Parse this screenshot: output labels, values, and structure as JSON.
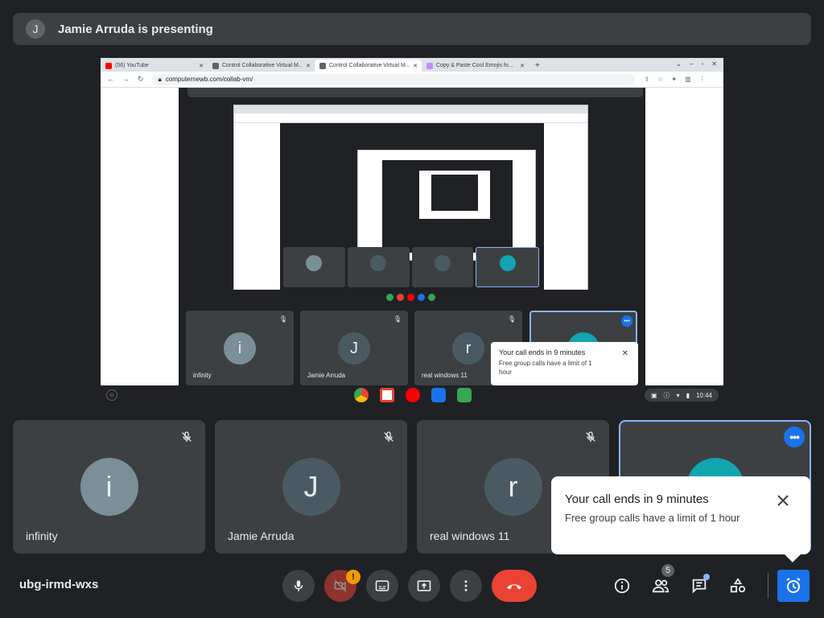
{
  "banner": {
    "avatar_letter": "J",
    "text": "Jamie Arruda is presenting"
  },
  "browser": {
    "tabs": [
      {
        "label": "(56) YouTube",
        "color": "#ff0000"
      },
      {
        "label": "Control Collaborative Virtual M...",
        "color": "#5f6368"
      },
      {
        "label": "Control Collaborative Virtual M...",
        "color": "#5f6368",
        "active": true
      },
      {
        "label": "Copy & Paste Cool Emojis fo...",
        "color": "#c58af9"
      }
    ],
    "url": "computernewb.com/collab-vm/"
  },
  "presentation_tiles": [
    {
      "letter": "i",
      "name": "infinity",
      "color": "#7b8f99"
    },
    {
      "letter": "J",
      "name": "Jamie Arruda",
      "color": "#4a5a63"
    },
    {
      "letter": "r",
      "name": "real windows 11",
      "color": "#4a5a63"
    }
  ],
  "presentation_toast": {
    "title": "Your call ends in 9 minutes",
    "body": "Free group calls have a limit of 1 hour"
  },
  "shelf": {
    "time": "10:44"
  },
  "tiles": [
    {
      "letter": "i",
      "name": "infinity",
      "color": "#7b8f99"
    },
    {
      "letter": "J",
      "name": "Jamie Arruda",
      "color": "#4a5a63"
    },
    {
      "letter": "r",
      "name": "real windows 11",
      "color": "#4a5a63"
    }
  ],
  "toast": {
    "title": "Your call ends in 9 minutes",
    "body": "Free group calls have a limit of 1 hour"
  },
  "controls": {
    "meeting_code": "ubg-irmd-wxs",
    "camera_warning": "!",
    "people_count": "5"
  },
  "colors": {
    "accent": "#1a73e8",
    "hangup": "#ea4335",
    "tile_bg": "#3c4043",
    "teal_avatar": "#12a4af"
  }
}
